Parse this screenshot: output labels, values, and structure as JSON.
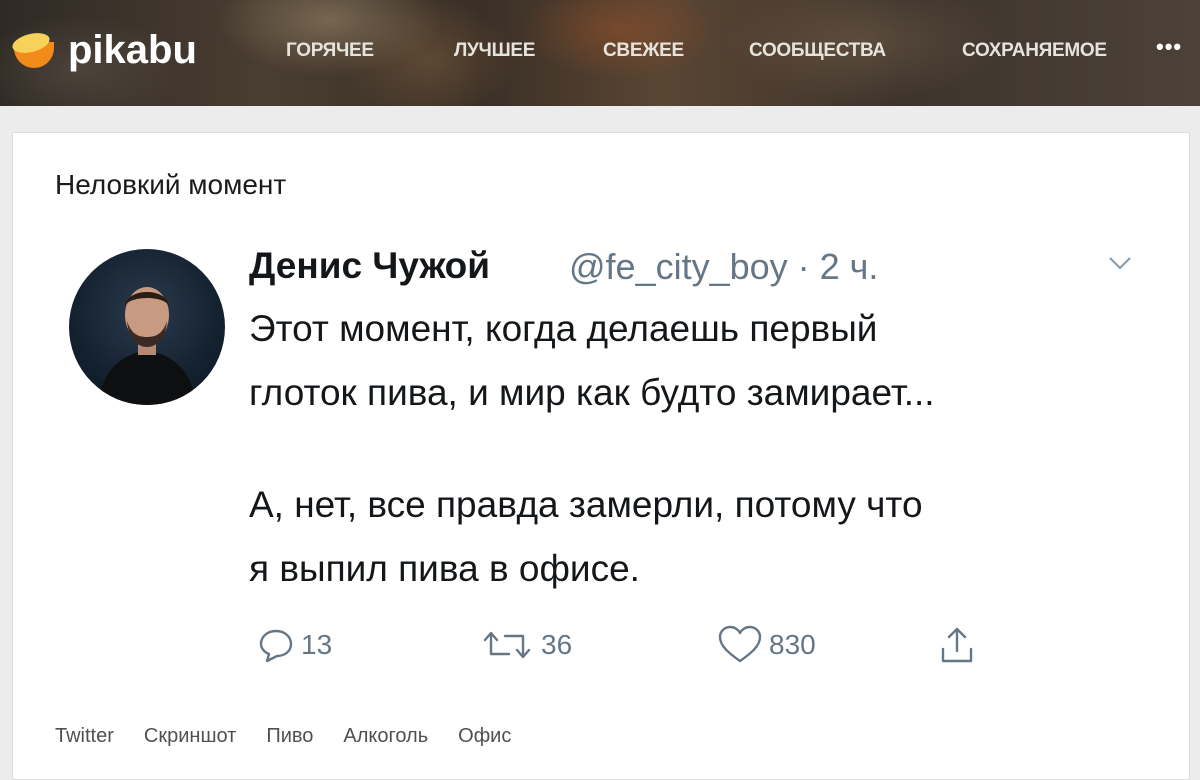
{
  "header": {
    "logo_text": "pikabu",
    "nav": [
      {
        "label": "ГОРЯЧЕЕ"
      },
      {
        "label": "ЛУЧШЕЕ"
      },
      {
        "label": "СВЕЖЕЕ"
      },
      {
        "label": "СООБЩЕСТВА"
      },
      {
        "label": "СОХРАНЯЕМОЕ"
      }
    ],
    "more": "•••"
  },
  "post": {
    "title": "Неловкий момент",
    "tweet": {
      "author_name": "Денис Чужой",
      "author_handle": "@fe_city_boy · 2 ч.",
      "lines": [
        "Этот момент, когда делаешь первый",
        "глоток пива, и мир как будто замирает...",
        "А, нет, все правда замерли, потому что",
        "я выпил пива в офисе."
      ],
      "replies": "13",
      "retweets": "36",
      "likes": "830"
    },
    "tags": [
      "Twitter",
      "Скриншот",
      "Пиво",
      "Алкоголь",
      "Офис"
    ]
  },
  "colors": {
    "accent": "#f28b1a",
    "muted": "#657786"
  }
}
